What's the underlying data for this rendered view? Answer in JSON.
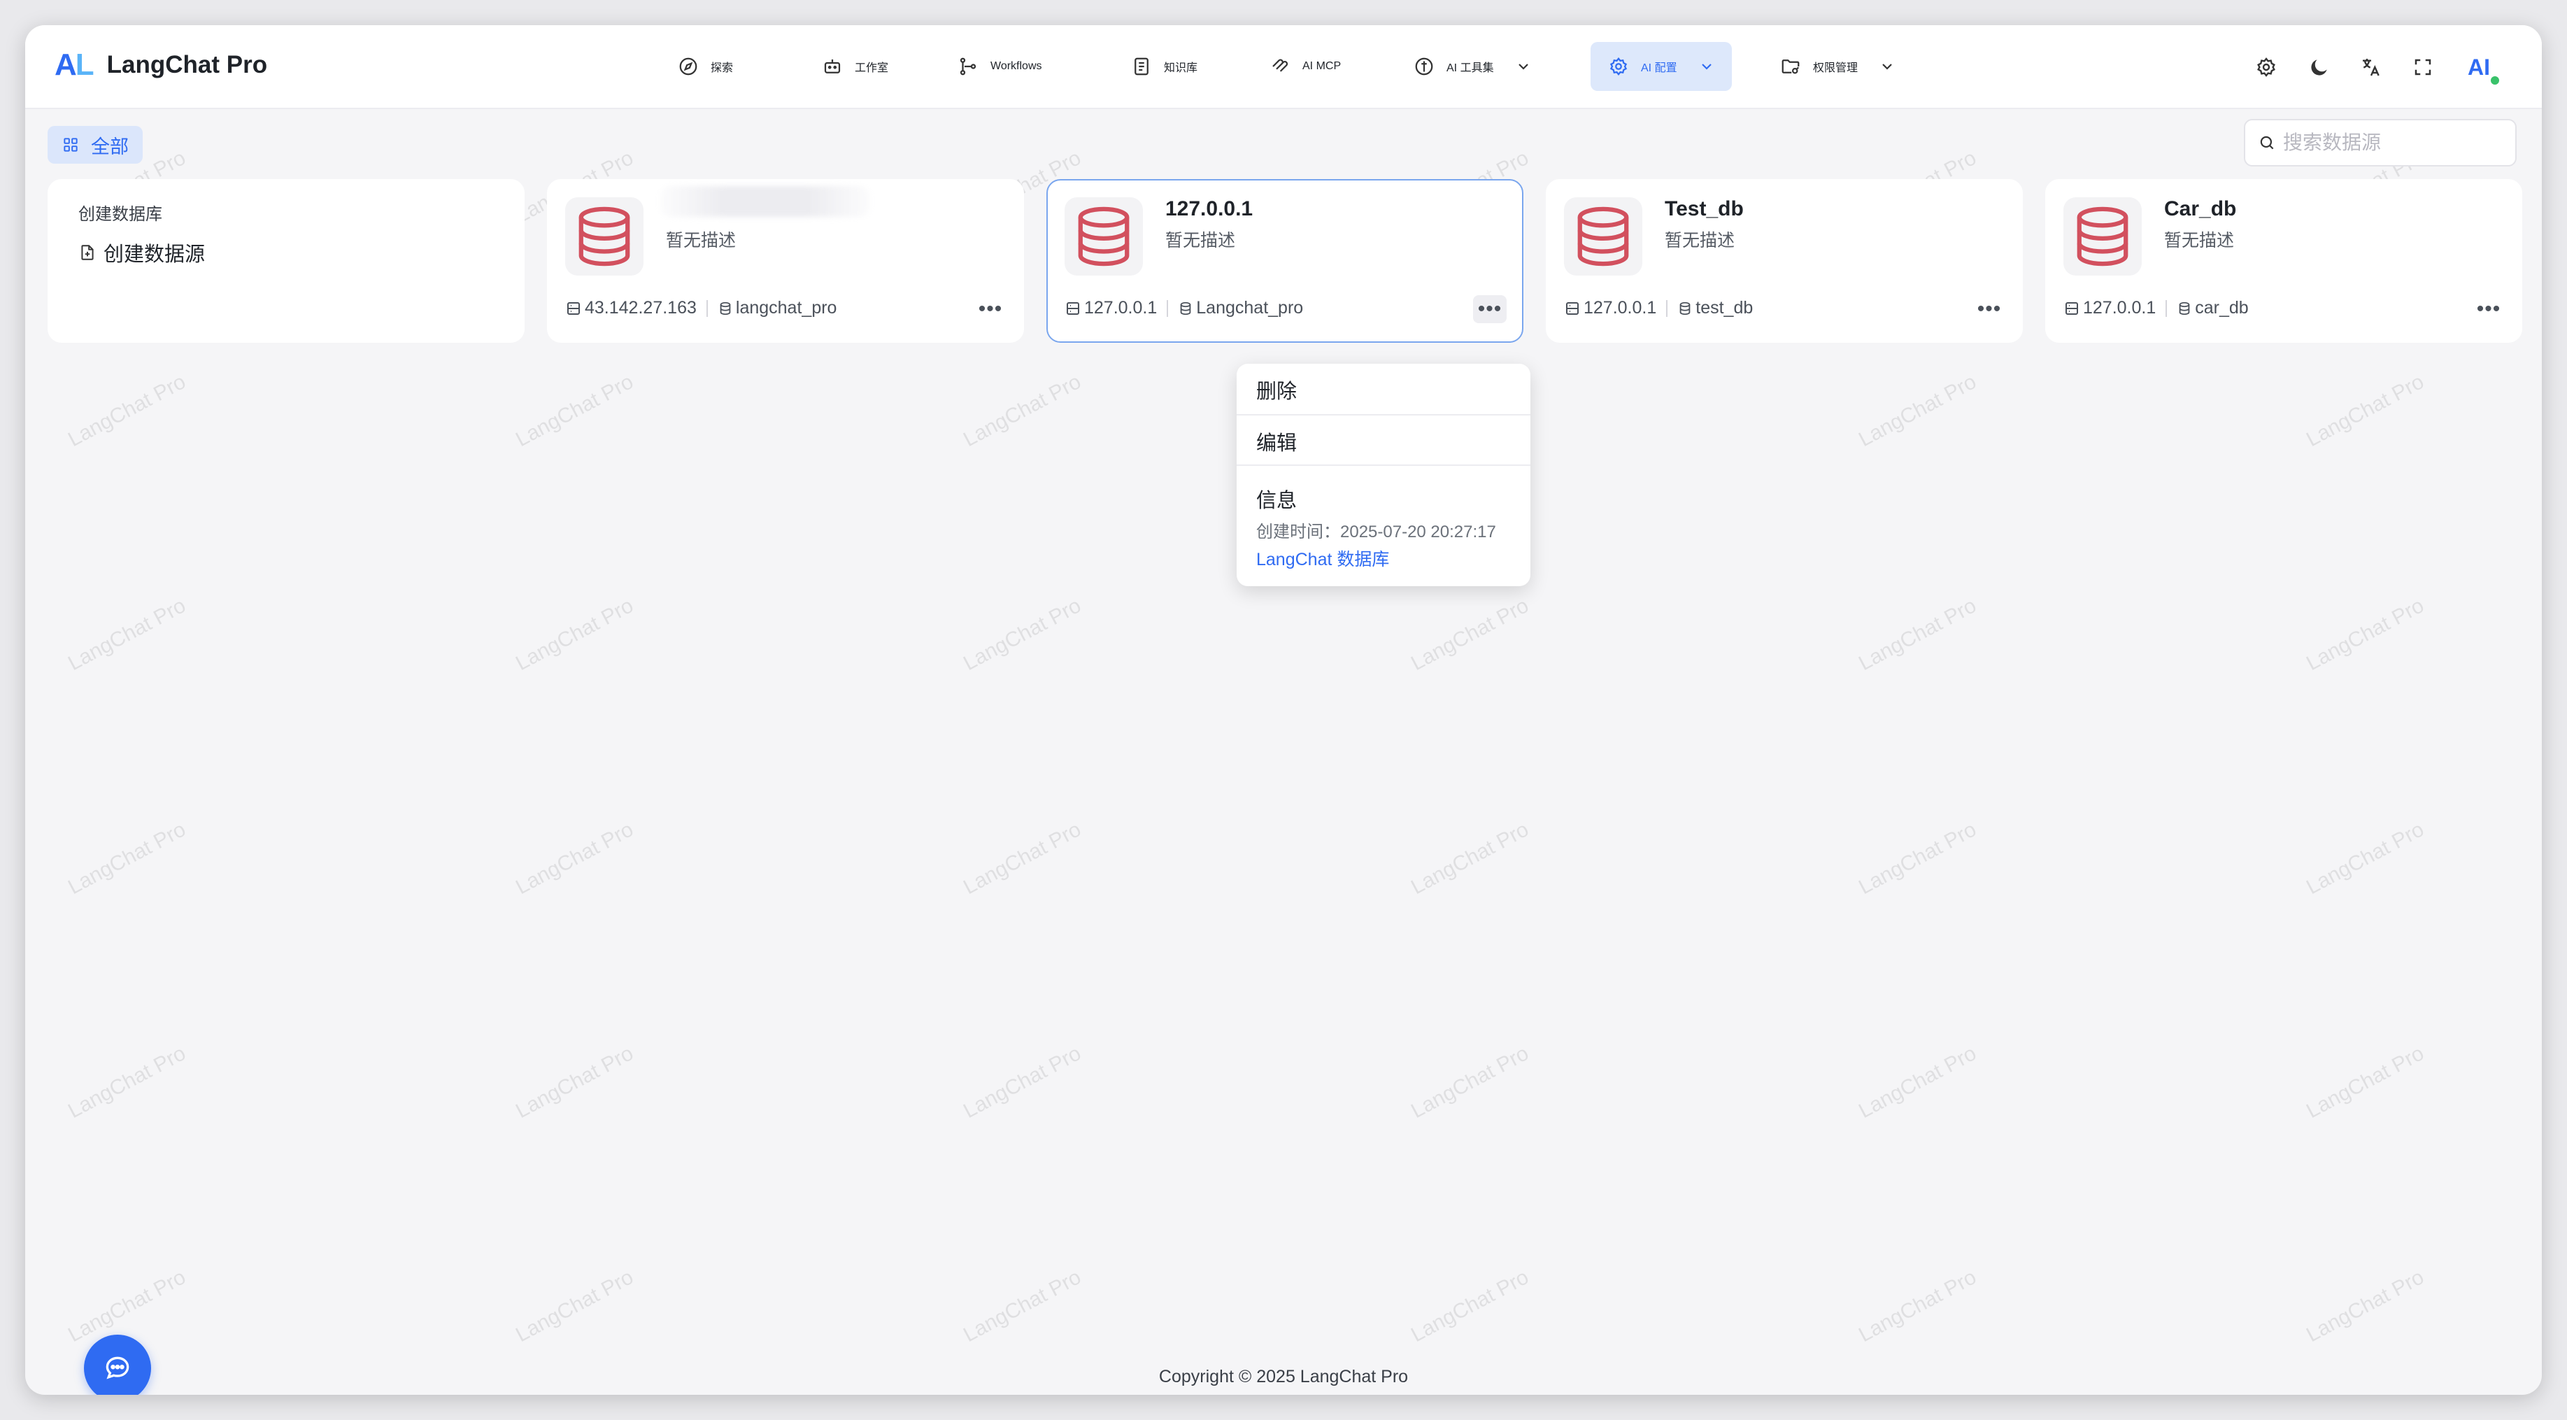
{
  "app": {
    "title": "LangChat Pro",
    "logo_mark_a": "A",
    "logo_mark_l": "L"
  },
  "nav": [
    {
      "label": "探索",
      "icon": "compass-icon"
    },
    {
      "label": "工作室",
      "icon": "robot-icon"
    },
    {
      "label": "Workflows",
      "icon": "workflow-icon"
    },
    {
      "label": "知识库",
      "icon": "book-icon"
    },
    {
      "label": "AI MCP",
      "icon": "mcp-icon"
    },
    {
      "label": "AI 工具集",
      "icon": "toolbox-icon",
      "has_dropdown": true
    },
    {
      "label": "AI 配置",
      "icon": "gear-icon",
      "has_dropdown": true,
      "active": true
    },
    {
      "label": "权限管理",
      "icon": "folder-key-icon",
      "has_dropdown": true
    }
  ],
  "header_icons": [
    "settings-icon",
    "moon-icon",
    "translate-icon",
    "fullscreen-icon"
  ],
  "avatar": {
    "text": "AI"
  },
  "filter": {
    "label": "全部"
  },
  "search": {
    "placeholder": "搜索数据源"
  },
  "create_card": {
    "title": "创建数据库",
    "link": "创建数据源"
  },
  "cards": [
    {
      "name": "",
      "desc": "暂无描述",
      "host": "43.142.27.163",
      "db": "langchat_pro",
      "name_blurred": true
    },
    {
      "name": "127.0.0.1",
      "desc": "暂无描述",
      "host": "127.0.0.1",
      "db": "Langchat_pro",
      "selected": true
    },
    {
      "name": "Test_db",
      "desc": "暂无描述",
      "host": "127.0.0.1",
      "db": "test_db"
    },
    {
      "name": "Car_db",
      "desc": "暂无描述",
      "host": "127.0.0.1",
      "db": "car_db"
    }
  ],
  "more_label": "•••",
  "dropdown": {
    "delete": "删除",
    "edit": "编辑",
    "info_title": "信息",
    "created_time": "创建时间：2025-07-20 20:27:17",
    "link": "LangChat 数据库"
  },
  "watermark": "LangChat Pro",
  "footer": {
    "copyright": "Copyright © 2025 LangChat Pro"
  },
  "colors": {
    "accent": "#2f6bf2",
    "db_icon": "#d2505e",
    "active_bg": "#dde8fb"
  }
}
